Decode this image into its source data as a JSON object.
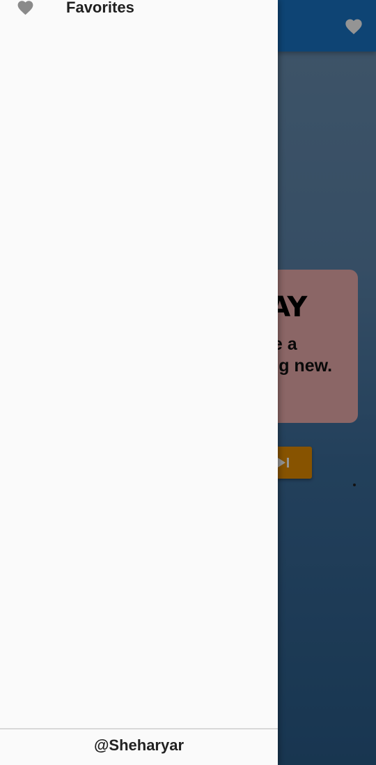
{
  "background_screen": {
    "card": {
      "title": "DAY",
      "line1": "ile a",
      "line2": "ing new."
    },
    "colors": {
      "appbar": "#1976c9",
      "card": "#f0b0b0",
      "next_button": "#e89000"
    },
    "appbar_icon": "heart-icon",
    "next_button_icon": "skip-next-icon"
  },
  "drawer": {
    "items": [
      {
        "label": "Favorites",
        "icon": "heart-icon"
      }
    ],
    "footer": "@Sheharyar",
    "colors": {
      "background": "#fafafa",
      "icon": "#8a8a8a"
    }
  }
}
